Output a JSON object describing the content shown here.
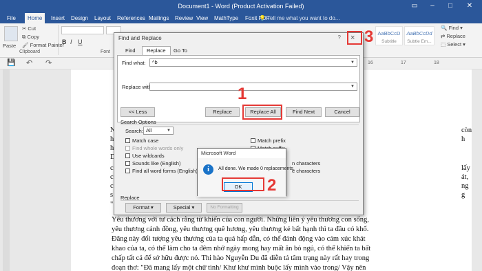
{
  "window": {
    "title": "Document1 - Word (Product Activation Failed)"
  },
  "ribbon_tabs": [
    "File",
    "Home",
    "Insert",
    "Design",
    "Layout",
    "References",
    "Mailings",
    "Review",
    "View",
    "MathType",
    "Foxit PDF"
  ],
  "tell_me": "Tell me what you want to do...",
  "ribbon": {
    "cut": "Cut",
    "copy": "Copy",
    "paste": "Paste",
    "format_painter": "Format Painter",
    "clipboard": "Clipboard",
    "font_group": "Font",
    "find": "Find",
    "replace": "Replace",
    "select": "Select",
    "styles": [
      {
        "preview": "AaBbCcD",
        "name": "Subtitle"
      },
      {
        "preview": "AaBbCcDd",
        "name": "Subtle Em..."
      }
    ]
  },
  "ruler_marks": [
    "16",
    "17",
    "18"
  ],
  "document_lines": [
    "Yêu thương với tư cách rằng từ khiến của con người. Những liên ý yêu thương con sống,",
    "yêu thương cảnh đồng, yêu thương quê hương, yêu thương kẻ bất hạnh thì ta đâu có khổ.",
    "Đăng này đổi tượng yêu thương của ta quá hấp dẫn, có thể đánh động vào cảm xúc khát",
    "khao của ta, có thể làm cho ta đêm nhớ ngày mong hay mất ăn bỏ ngủ, có thể khiến ta bất",
    "chấp tất cả để sở hữu được nó. Thi hào Nguyễn Du đã diễn tả tâm trạng này rất hay trong",
    "đoạn thơ: \"Đã mang lấy một chữ tình/ Khư khư mình buộc lấy mình vào trong/ Vậy nên"
  ],
  "left_fragments": [
    "N",
    "h",
    "h",
    "D",
    "c",
    "c",
    "c",
    "s",
    "\""
  ],
  "right_fragments": [
    "còn",
    "h",
    "lấy",
    "át,",
    "ng",
    "g"
  ],
  "find_replace": {
    "title": "Find and Replace",
    "help": "?",
    "close": "×",
    "tabs": [
      "Find",
      "Replace",
      "Go To"
    ],
    "find_what_label": "Find what:",
    "find_what_value": "^b",
    "replace_with_label": "Replace with:",
    "replace_with_value": "",
    "less_button": "<< Less",
    "replace_button": "Replace",
    "replace_all_button": "Replace All",
    "find_next_button": "Find Next",
    "cancel_button": "Cancel",
    "search_options_label": "Search Options",
    "search_label": "Search:",
    "search_value": "All",
    "options_left": [
      {
        "label": "Match case",
        "dim": false
      },
      {
        "label": "Find whole words only",
        "dim": true
      },
      {
        "label": "Use wildcards",
        "dim": false
      },
      {
        "label": "Sounds like (English)",
        "dim": false
      },
      {
        "label": "Find all word forms (English)",
        "dim": false
      }
    ],
    "options_right": [
      {
        "label": "Match prefix"
      },
      {
        "label": "Match suffix"
      },
      {
        "label": "n characters"
      },
      {
        "label": "e characters"
      }
    ],
    "replace_section_label": "Replace",
    "format_button": "Format ▾",
    "special_button": "Special ▾",
    "no_formatting_button": "No Formatting"
  },
  "message_box": {
    "title": "Microsoft Word",
    "message": "All done. We made 0 replacements.",
    "ok": "OK",
    "icon": "info-icon"
  },
  "callouts": [
    "1",
    "2",
    "3"
  ],
  "colors": {
    "title_bar": "#2b579a",
    "callout": "#e53935",
    "info": "#1a73c8"
  }
}
